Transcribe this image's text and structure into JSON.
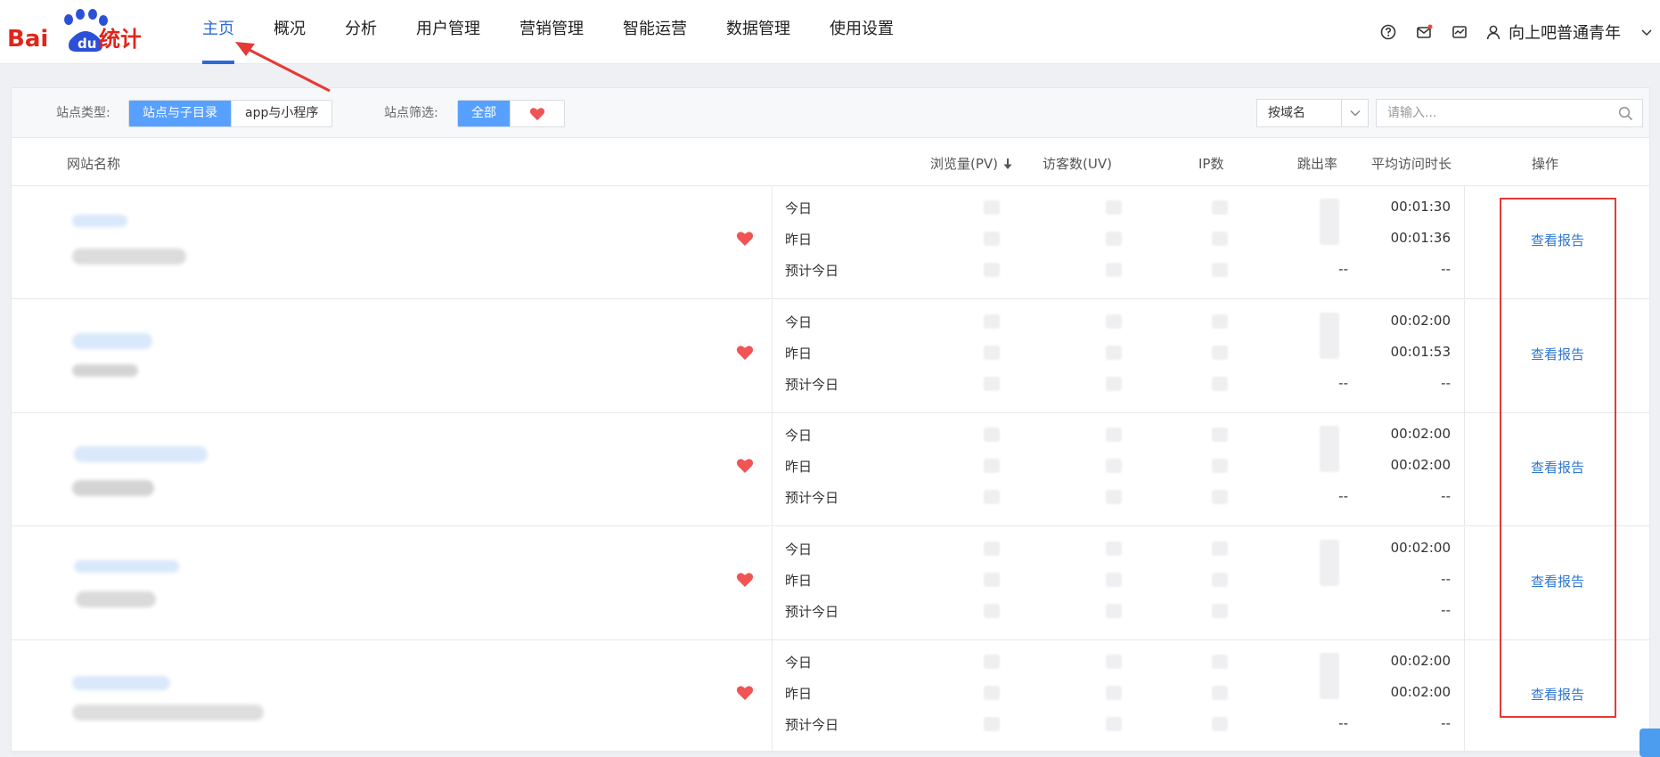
{
  "header": {
    "logo_text": "Baidu统计",
    "nav": [
      {
        "label": "主页",
        "active": true
      },
      {
        "label": "概况"
      },
      {
        "label": "分析"
      },
      {
        "label": "用户管理"
      },
      {
        "label": "营销管理"
      },
      {
        "label": "智能运营"
      },
      {
        "label": "数据管理"
      },
      {
        "label": "使用设置"
      }
    ],
    "icons": [
      "help-icon",
      "message-icon",
      "monitor-icon"
    ],
    "user_name": "向上吧普通青年",
    "accent": "#2b6ad6"
  },
  "filters": {
    "site_type_label": "站点类型:",
    "site_type_options": [
      "站点与子目录",
      "app与小程序"
    ],
    "site_filter_label": "站点筛选:",
    "site_filter_all": "全部",
    "domain_select": "按域名",
    "search_placeholder": "请输入..."
  },
  "table": {
    "headers": {
      "site": "网站名称",
      "pv": "浏览量(PV)",
      "uv": "访客数(UV)",
      "ip": "IP数",
      "bounce": "跳出率",
      "avg": "平均访问时长",
      "op": "操作"
    },
    "row_labels": [
      "今日",
      "昨日",
      "预计今日"
    ],
    "report_label": "查看报告",
    "rows": [
      {
        "avg": [
          "00:01:30",
          "00:01:36",
          "--"
        ],
        "bounce3": "--"
      },
      {
        "avg": [
          "00:02:00",
          "00:01:53",
          "--"
        ],
        "bounce3": "--"
      },
      {
        "avg": [
          "00:02:00",
          "00:02:00",
          "--"
        ],
        "bounce3": "--"
      },
      {
        "avg": [
          "00:02:00",
          "--",
          "--"
        ],
        "bounce3": ""
      },
      {
        "avg": [
          "00:02:00",
          "00:02:00",
          "--"
        ],
        "bounce3": "--"
      }
    ]
  }
}
